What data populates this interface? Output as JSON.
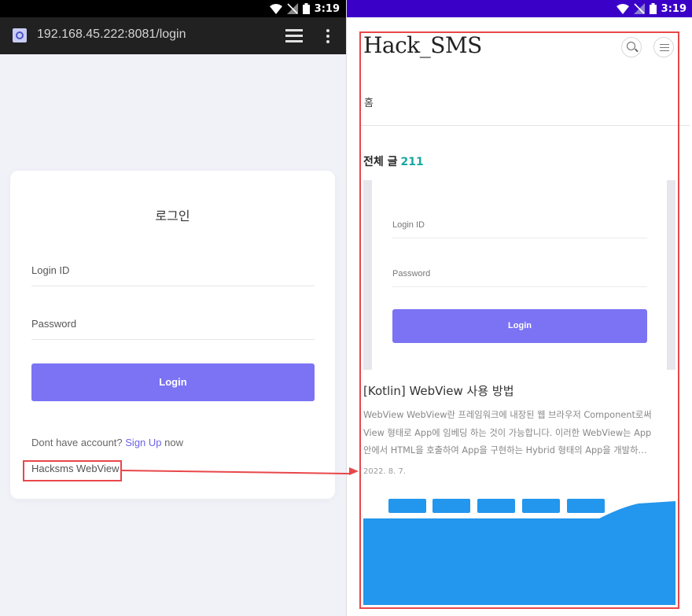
{
  "left": {
    "status": {
      "time": "3:19"
    },
    "browser": {
      "url": "192.168.45.222:8081/login"
    },
    "login": {
      "title": "로그인",
      "id_placeholder": "Login ID",
      "password_placeholder": "Password",
      "button": "Login",
      "signup_prefix": "Dont have account?",
      "signup_link": "Sign Up",
      "signup_suffix": "now",
      "webview_link": "Hacksms WebView"
    }
  },
  "right": {
    "status": {
      "time": "3:19"
    },
    "blog": {
      "title": "Hack_SMS",
      "nav_home": "홈",
      "total_label": "전체 글",
      "total_count": "211"
    },
    "thumbnail": {
      "id_label": "Login ID",
      "password_label": "Password",
      "button": "Login"
    },
    "post": {
      "title": "[Kotlin] WebView 사용 방법",
      "excerpt_lines": [
        "WebView WebView란 프레임워크에 내장된 웹 브라우저 Component로써",
        "View 형태로 App에 임베딩 하는 것이 가능합니다. 이러한 WebView는 App",
        "안에서 HTML을 호출하여 App을 구현하는 Hybrid 형태의 App을 개발하…"
      ],
      "date": "2022. 8. 7."
    }
  },
  "colors": {
    "accent_purple": "#7b73f4",
    "highlight_red": "#e8474a",
    "count_teal": "#1aa7a1",
    "docker_blue": "#2396ed"
  }
}
